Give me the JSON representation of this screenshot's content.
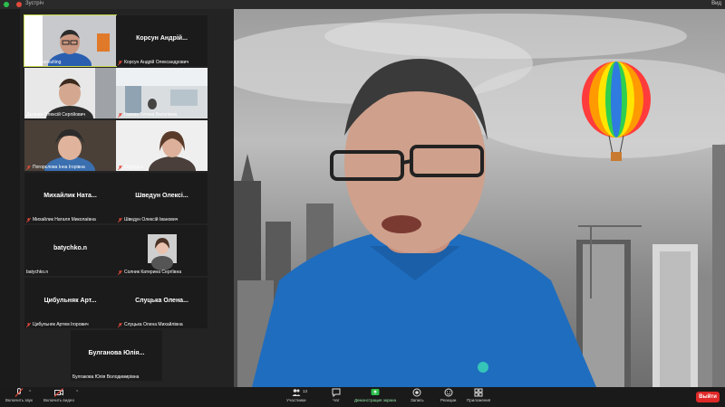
{
  "window": {
    "title": "Зустріч",
    "view_label": "Вид"
  },
  "tiles": [
    {
      "label": "ЮРІЯ Consulting",
      "display": "",
      "muted": false,
      "active": true,
      "video": "man-glasses"
    },
    {
      "label": "Корсун Андрій Олександрович",
      "display": "Корсун Андрій...",
      "muted": true,
      "active": false,
      "video": ""
    },
    {
      "label": "Дьошин Олексій Сергійович",
      "display": "",
      "muted": false,
      "active": false,
      "video": "man"
    },
    {
      "label": "Галаза Тетяна Василівна",
      "display": "",
      "muted": true,
      "active": false,
      "video": "office"
    },
    {
      "label": "Погорєлова Інна Ігорівна",
      "display": "",
      "muted": true,
      "active": false,
      "video": "woman-hat"
    },
    {
      "label": "iGryuga.n",
      "display": "",
      "muted": true,
      "active": false,
      "video": "woman"
    },
    {
      "label": "Михайлик Наталя Миколаївна",
      "display": "Михайлик Ната...",
      "muted": true,
      "active": false,
      "video": ""
    },
    {
      "label": "Шведун Олексій Іванович",
      "display": "Шведун Олексі...",
      "muted": true,
      "active": false,
      "video": ""
    },
    {
      "label": "batychko.n",
      "display": "batychko.n",
      "muted": false,
      "active": false,
      "video": ""
    },
    {
      "label": "Солник Катерина Сергіївна",
      "display": "",
      "muted": true,
      "active": false,
      "video": "photo"
    },
    {
      "label": "Цибульняк Артем Ігорович",
      "display": "Цибульняк Арт...",
      "muted": true,
      "active": false,
      "video": ""
    },
    {
      "label": "Слуцька Олена Михайлівна",
      "display": "Слуцька Олена...",
      "muted": true,
      "active": false,
      "video": ""
    },
    {
      "label": "Булгакова Юлія Володимирівна",
      "display": "Булганова Юлія...",
      "muted": false,
      "active": false,
      "video": ""
    }
  ],
  "toolbar": {
    "audio": "Включить звук",
    "video": "Включить видео",
    "participants": "Участники",
    "participants_count": "13",
    "chat": "Чат",
    "share": "Демонстрация экрана",
    "record": "Запись",
    "reactions": "Реакции",
    "apps": "Приложения",
    "leave": "Выйти"
  },
  "colors": {
    "accent": "#2dbf4d",
    "leave": "#e02828",
    "active_border": "#c8d94a",
    "muted": "#e24a3b"
  }
}
